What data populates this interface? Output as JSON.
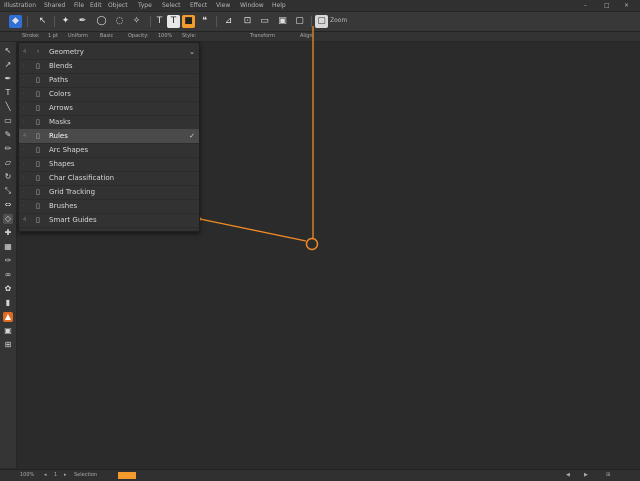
{
  "menubar": {
    "items": [
      "Illustration",
      "Shared",
      "File",
      "Edit",
      "Object",
      "Type",
      "Select",
      "Effect",
      "View",
      "Window",
      "Help"
    ],
    "window_controls": [
      "–",
      "□",
      "×"
    ]
  },
  "toolbar": {
    "buttons": [
      {
        "name": "app-logo-icon",
        "glyph": "◆"
      },
      {
        "name": "selection-icon",
        "glyph": "↖"
      },
      {
        "name": "magic-wand-icon",
        "glyph": "✦"
      },
      {
        "name": "pen-icon",
        "glyph": "✒"
      },
      {
        "name": "shape-icon",
        "glyph": "◯"
      },
      {
        "name": "lasso-icon",
        "glyph": "◌"
      },
      {
        "name": "move-icon",
        "glyph": "✧"
      },
      {
        "name": "text-icon",
        "glyph": "T"
      },
      {
        "name": "fill-icon",
        "glyph": "■"
      },
      {
        "name": "chat-icon",
        "glyph": "❝"
      },
      {
        "name": "align-icon",
        "glyph": "⊿"
      },
      {
        "name": "frame-icon",
        "glyph": "⊡"
      },
      {
        "name": "image-icon",
        "glyph": "▭"
      },
      {
        "name": "layers-icon",
        "glyph": "▣"
      },
      {
        "name": "arrange-icon",
        "glyph": "▢"
      }
    ],
    "zoom_label": "Zoom",
    "accent_color": "#f39c2d",
    "brand_color": "#2f6fd6"
  },
  "options_bar": {
    "items": [
      "Stroke:",
      "1 pt",
      "Uniform",
      "Basic",
      "Opacity:",
      "100%",
      "Style:",
      "Transform",
      "Align"
    ]
  },
  "tools": {
    "items": [
      "arrow-icon",
      "direct-select-icon",
      "pen-tool-icon",
      "type-tool-icon",
      "line-tool-icon",
      "rectangle-icon",
      "paintbrush-icon",
      "pencil-icon",
      "eraser-icon",
      "rotate-icon",
      "scale-icon",
      "width-icon",
      "warp-icon",
      "shape-builder-icon",
      "gradient-icon",
      "eyedropper-icon",
      "blend-icon",
      "symbol-icon",
      "graph-icon",
      "artboard-icon",
      "slice-icon",
      "hand-icon",
      "zoom-icon",
      "fill-stroke-icon",
      "draw-mode-icon",
      "screen-mode-icon"
    ]
  },
  "dropdown": {
    "items": [
      {
        "num": "4",
        "icon": "◦",
        "label": "Geometry",
        "selected": false,
        "check": "⌄"
      },
      {
        "num": "·",
        "icon": "▯",
        "label": "Blends",
        "selected": false,
        "check": ""
      },
      {
        "num": "·",
        "icon": "▯",
        "label": "Paths",
        "selected": false,
        "check": ""
      },
      {
        "num": "·",
        "icon": "▯",
        "label": "Colors",
        "selected": false,
        "check": ""
      },
      {
        "num": "·",
        "icon": "▯",
        "label": "Arrows",
        "selected": false,
        "check": ""
      },
      {
        "num": "·",
        "icon": "▯",
        "label": "Masks",
        "selected": false,
        "check": ""
      },
      {
        "num": "4",
        "icon": "▯",
        "label": "Rules",
        "selected": true,
        "check": "✓"
      },
      {
        "num": "·",
        "icon": "▯",
        "label": "Arc Shapes",
        "selected": false,
        "check": ""
      },
      {
        "num": "·",
        "icon": "▯",
        "label": "Shapes",
        "selected": false,
        "check": ""
      },
      {
        "num": "·",
        "icon": "▯",
        "label": "Char Classification",
        "selected": false,
        "check": ""
      },
      {
        "num": "·",
        "icon": "▯",
        "label": "Grid Tracking",
        "selected": false,
        "check": ""
      },
      {
        "num": "·",
        "icon": "▯",
        "label": "Brushes",
        "selected": false,
        "check": ""
      },
      {
        "num": "4",
        "icon": "▯",
        "label": "Smart Guides",
        "selected": false,
        "check": ""
      }
    ]
  },
  "statusbar": {
    "items": [
      "100%",
      "◂",
      "1",
      "▸",
      "Selection"
    ],
    "right": [
      "◀",
      "▶",
      "⊞"
    ]
  },
  "overlay": {
    "line_color": "#f08a24"
  }
}
